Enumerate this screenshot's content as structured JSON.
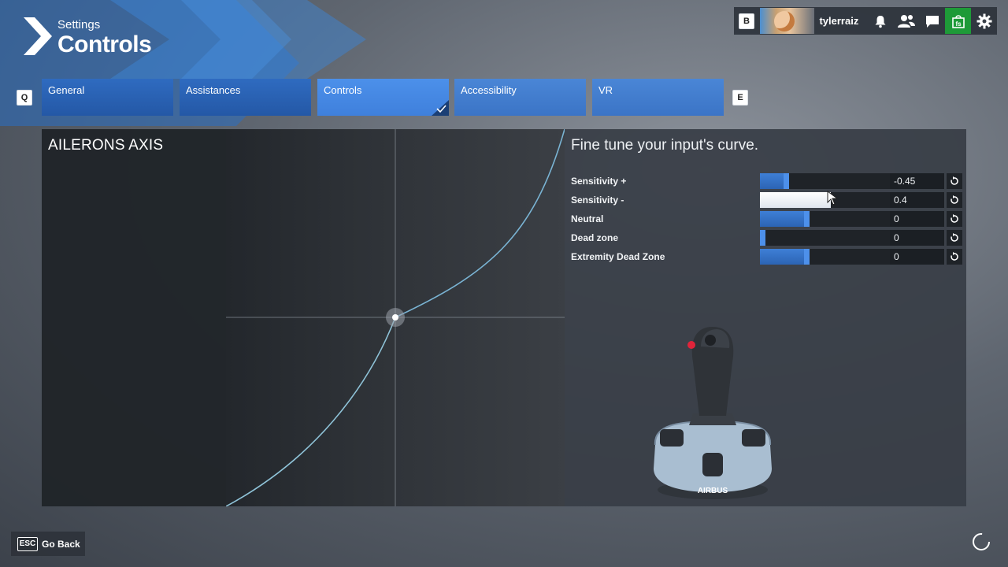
{
  "header": {
    "subtitle": "Settings",
    "title": "Controls"
  },
  "topbar": {
    "key_b": "B",
    "username": "tylerraiz",
    "icons": [
      "bell-icon",
      "friends-icon",
      "chat-icon",
      "marketplace-icon",
      "gear-icon"
    ]
  },
  "tabs": {
    "key_prev": "Q",
    "key_next": "E",
    "items": [
      {
        "label": "General"
      },
      {
        "label": "Assistances"
      },
      {
        "label": "Controls",
        "active": true
      },
      {
        "label": "Accessibility"
      },
      {
        "label": "VR"
      }
    ]
  },
  "axis_panel": {
    "title": "AILERONS AXIS"
  },
  "curve_panel": {
    "title": "Fine tune your input's curve.",
    "rows": [
      {
        "label": "Sensitivity +",
        "value": "-0.45",
        "fill": 0.2
      },
      {
        "label": "Sensitivity -",
        "value": "0.4",
        "fill": 0.52
      },
      {
        "label": "Neutral",
        "value": "0",
        "fill": 0.36
      },
      {
        "label": "Dead zone",
        "value": "0",
        "fill": 0.0
      },
      {
        "label": "Extremity Dead Zone",
        "value": "0",
        "fill": 0.36
      }
    ]
  },
  "device": {
    "brand": "AIRBUS"
  },
  "footer": {
    "key": "ESC",
    "back_label": "Go Back"
  },
  "colors": {
    "accent": "#3f80dc",
    "tab": "#2458a6",
    "green": "#1e9a38"
  }
}
